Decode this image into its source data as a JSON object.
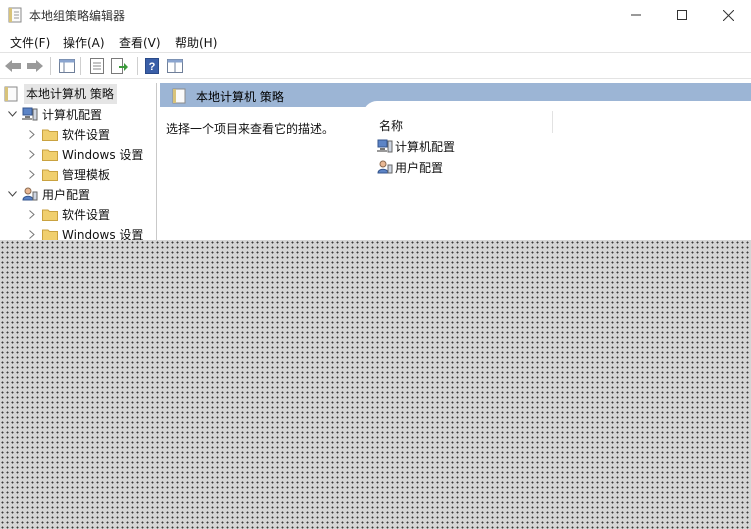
{
  "window": {
    "title": "本地组策略编辑器"
  },
  "menu": [
    "文件(F)",
    "操作(A)",
    "查看(V)",
    "帮助(H)"
  ],
  "toolbar": {
    "buttons": [
      "back-arrow-icon",
      "forward-arrow-icon",
      "show-tree-icon",
      "properties-icon",
      "export-icon",
      "help-icon",
      "view-icon"
    ]
  },
  "tree": {
    "root": "本地计算机 策略",
    "computer_config": "计算机配置",
    "computer_children": [
      "软件设置",
      "Windows 设置",
      "管理模板"
    ],
    "user_config": "用户配置",
    "user_children": [
      "软件设置",
      "Windows 设置"
    ]
  },
  "detail": {
    "header": "本地计算机 策略",
    "description": "选择一个项目来查看它的描述。",
    "column_name": "名称",
    "items": [
      "计算机配置",
      "用户配置"
    ]
  },
  "colors": {
    "header_band": "#9cb5d5",
    "selection": "#e5e5e5",
    "folder": "#e8c25a"
  }
}
